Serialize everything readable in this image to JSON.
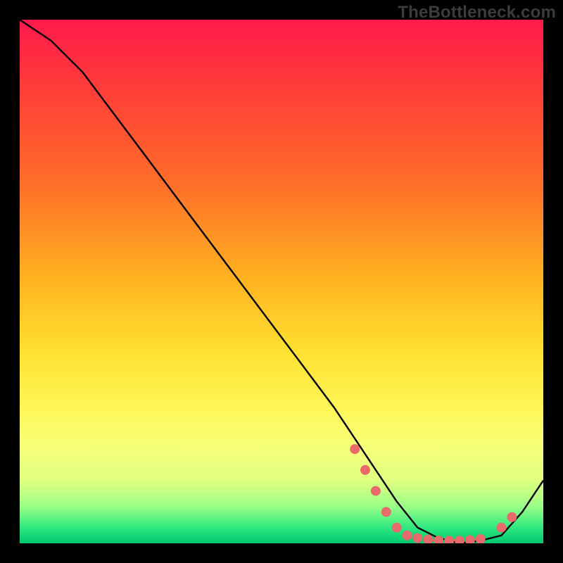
{
  "watermark": "TheBottleneck.com",
  "chart_data": {
    "type": "line",
    "title": "",
    "xlabel": "",
    "ylabel": "",
    "xlim": [
      0,
      100
    ],
    "ylim": [
      0,
      100
    ],
    "series": [
      {
        "name": "bottleneck-curve",
        "x": [
          0,
          6,
          12,
          18,
          24,
          30,
          36,
          42,
          48,
          54,
          60,
          64,
          68,
          72,
          76,
          80,
          84,
          88,
          92,
          96,
          100
        ],
        "y": [
          100,
          96,
          90,
          82,
          74,
          66,
          58,
          50,
          42,
          34,
          26,
          20,
          14,
          8,
          3,
          1,
          0,
          0.5,
          1.5,
          6,
          12
        ]
      }
    ],
    "markers": {
      "name": "highlight-dots",
      "color": "#e86a6a",
      "points": [
        {
          "x": 64,
          "y": 18
        },
        {
          "x": 66,
          "y": 14
        },
        {
          "x": 68,
          "y": 10
        },
        {
          "x": 70,
          "y": 6
        },
        {
          "x": 72,
          "y": 3
        },
        {
          "x": 74,
          "y": 1.5
        },
        {
          "x": 76,
          "y": 1
        },
        {
          "x": 78,
          "y": 0.7
        },
        {
          "x": 80,
          "y": 0.5
        },
        {
          "x": 82,
          "y": 0.5
        },
        {
          "x": 84,
          "y": 0.5
        },
        {
          "x": 86,
          "y": 0.6
        },
        {
          "x": 88,
          "y": 0.8
        },
        {
          "x": 92,
          "y": 3
        },
        {
          "x": 94,
          "y": 5
        }
      ]
    }
  }
}
